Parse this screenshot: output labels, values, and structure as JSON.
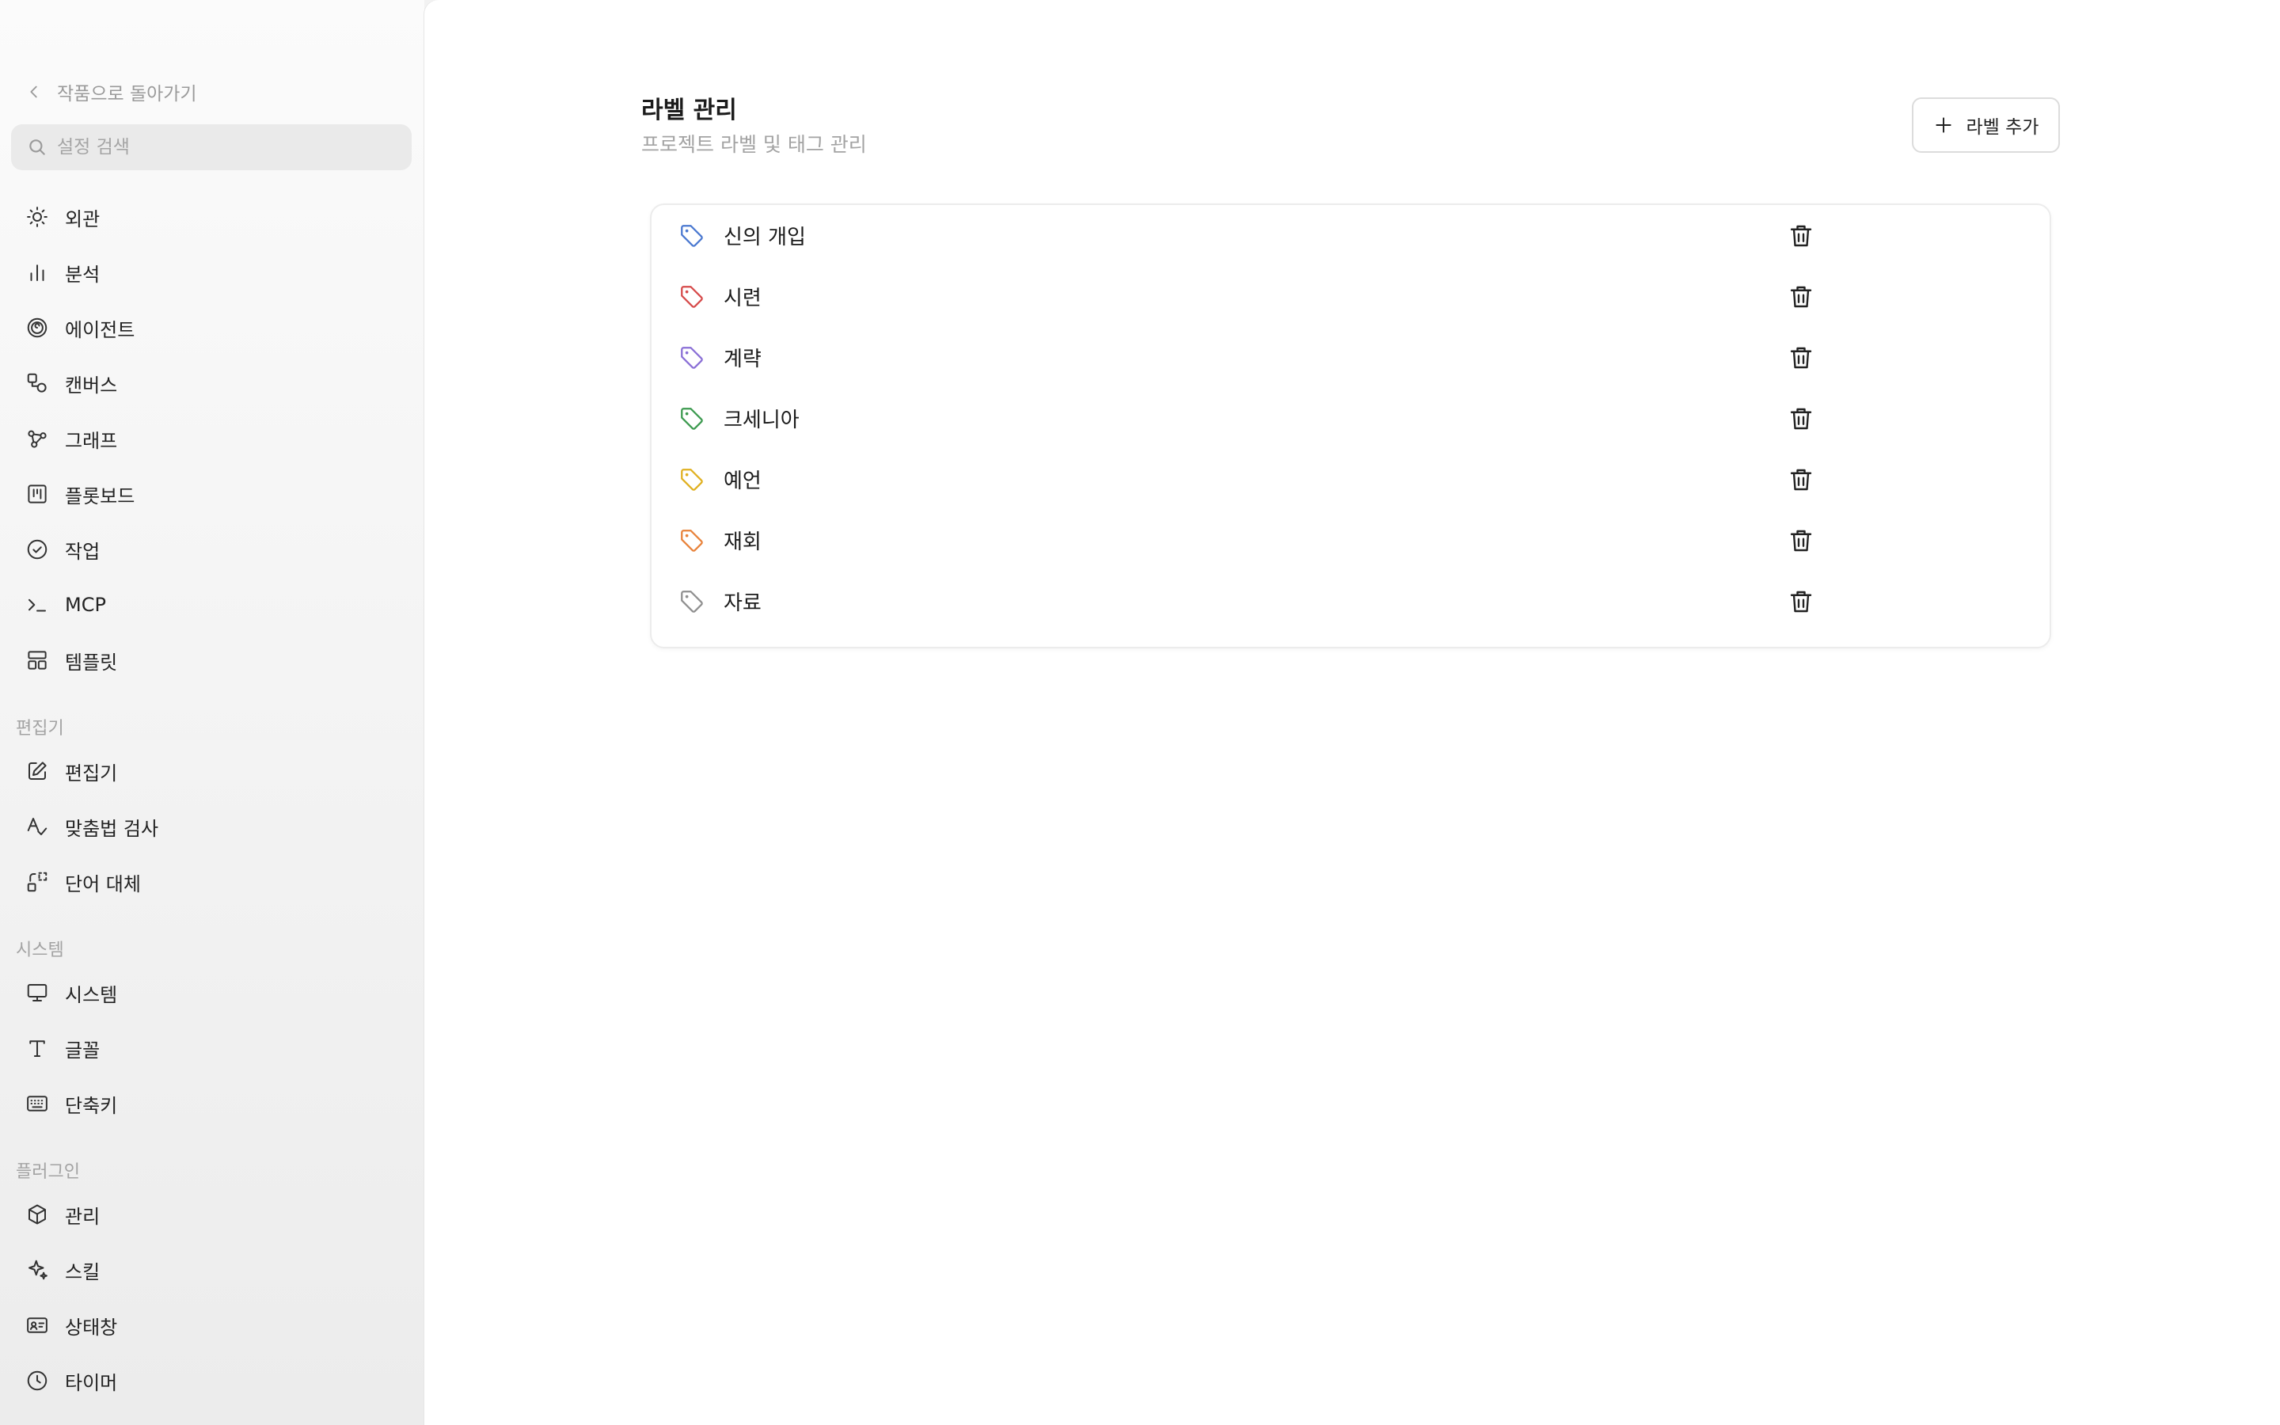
{
  "sidebar": {
    "back_label": "작품으로 돌아가기",
    "search_placeholder": "설정 검색",
    "items": [
      {
        "label": "외관",
        "icon": "sun-icon"
      },
      {
        "label": "분석",
        "icon": "bar-chart-icon"
      },
      {
        "label": "에이전트",
        "icon": "agent-spiral-icon"
      },
      {
        "label": "캔버스",
        "icon": "canvas-shapes-icon"
      },
      {
        "label": "그래프",
        "icon": "graph-nodes-icon"
      },
      {
        "label": "플롯보드",
        "icon": "plotboard-icon"
      },
      {
        "label": "작업",
        "icon": "check-circle-icon"
      },
      {
        "label": "MCP",
        "icon": "terminal-icon"
      },
      {
        "label": "템플릿",
        "icon": "template-grid-icon"
      }
    ],
    "sections": {
      "editor": {
        "title": "편집기",
        "items": [
          {
            "label": "편집기",
            "icon": "edit-square-icon"
          },
          {
            "label": "맞춤법 검사",
            "icon": "spellcheck-icon"
          },
          {
            "label": "단어 대체",
            "icon": "replace-icon"
          }
        ]
      },
      "system": {
        "title": "시스템",
        "items": [
          {
            "label": "시스템",
            "icon": "monitor-icon"
          },
          {
            "label": "글꼴",
            "icon": "font-icon"
          },
          {
            "label": "단축키",
            "icon": "keyboard-icon"
          }
        ]
      },
      "plugins": {
        "title": "플러그인",
        "items": [
          {
            "label": "관리",
            "icon": "package-icon"
          },
          {
            "label": "스킬",
            "icon": "sparkle-icon"
          },
          {
            "label": "상태창",
            "icon": "id-card-icon"
          },
          {
            "label": "타이머",
            "icon": "clock-icon"
          }
        ]
      }
    }
  },
  "main": {
    "title": "라벨 관리",
    "subtitle": "프로젝트 라벨 및 태그 관리",
    "add_button_label": "라벨 추가",
    "labels": [
      {
        "name": "신의 개입",
        "color": "#4a78d0"
      },
      {
        "name": "시련",
        "color": "#d64a4a"
      },
      {
        "name": "계략",
        "color": "#8a6fd6"
      },
      {
        "name": "크세니아",
        "color": "#3c9a4f"
      },
      {
        "name": "예언",
        "color": "#e0b020"
      },
      {
        "name": "재회",
        "color": "#e8823a"
      },
      {
        "name": "자료",
        "color": "#8f8f8f"
      }
    ]
  }
}
